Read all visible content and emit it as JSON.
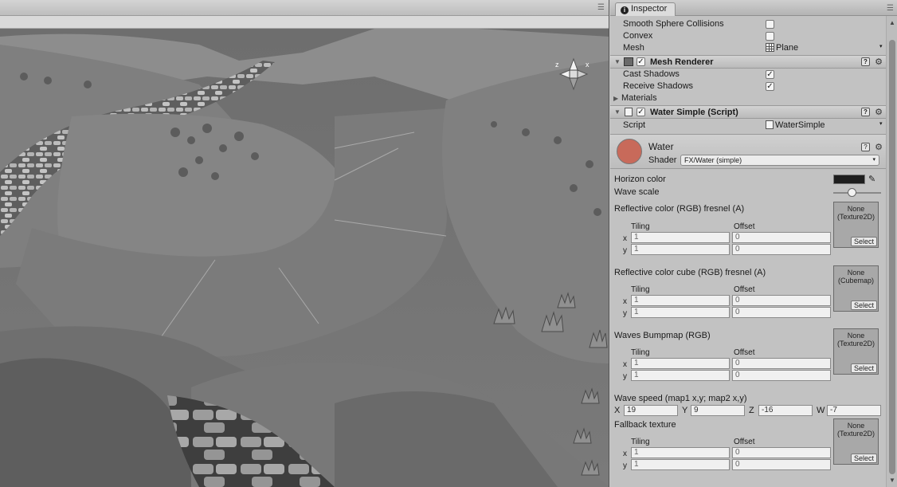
{
  "inspector": {
    "tab_label": "Inspector",
    "menu_glyph": "☰",
    "mesh_collider": {
      "smooth_sphere_label": "Smooth Sphere Collisions",
      "convex_label": "Convex",
      "mesh_label": "Mesh",
      "mesh_value": "Plane"
    },
    "mesh_renderer": {
      "title": "Mesh Renderer",
      "cast_shadows_label": "Cast Shadows",
      "receive_shadows_label": "Receive Shadows",
      "materials_label": "Materials",
      "cast_shadows_checked": true,
      "receive_shadows_checked": true
    },
    "water_script": {
      "title": "Water Simple (Script)",
      "script_label": "Script",
      "script_value": "WaterSimple"
    },
    "material": {
      "name": "Water",
      "shader_label": "Shader",
      "shader_value": "FX/Water (simple)",
      "horizon_color_label": "Horizon color",
      "wave_scale_label": "Wave scale",
      "wave_scale_fraction": 0.3
    },
    "textures": [
      {
        "label": "Reflective color (RGB) fresnel (A)",
        "slot": "None\n(Texture2D)",
        "slot_line1": "None",
        "slot_line2": "(Texture2D)"
      },
      {
        "label": "Reflective color cube (RGB) fresnel (A)",
        "slot_line1": "None",
        "slot_line2": "(Cubemap)"
      },
      {
        "label": "Waves Bumpmap (RGB)",
        "slot_line1": "None",
        "slot_line2": "(Texture2D)"
      },
      {
        "label": "Fallback texture",
        "slot_line1": "None",
        "slot_line2": "(Texture2D)"
      }
    ],
    "tiling_label": "Tiling",
    "offset_label": "Offset",
    "x_label": "x",
    "y_label": "y",
    "tiling_value": "1",
    "offset_value": "0",
    "select_label": "Select",
    "wave_speed": {
      "label": "Wave speed (map1 x,y; map2 x,y)",
      "X_label": "X",
      "X": "19",
      "Y_label": "Y",
      "Y": "9",
      "Z_label": "Z",
      "Z": "-16",
      "W_label": "W",
      "W": "-7"
    }
  },
  "scene": {
    "menu_glyph": "☰",
    "gizmo_x": "x",
    "gizmo_z": "z"
  },
  "colors": {
    "inspector_bg": "#c2c2c2",
    "header_bg": "#c6c6c6",
    "water_swatch": "#c86a5a",
    "horizon_swatch": "#1e1e1e"
  }
}
